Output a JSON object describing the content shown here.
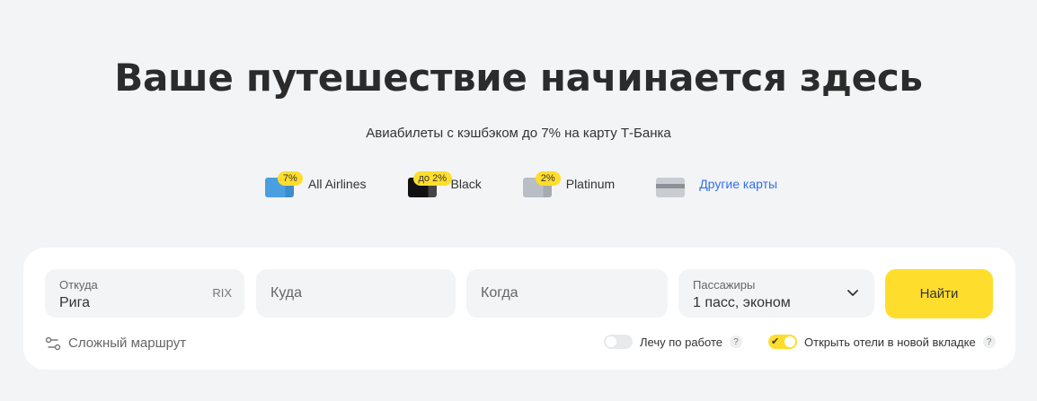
{
  "hero": {
    "title": "Ваше путешествие начинается здесь",
    "subtitle": "Авиабилеты с кэшбэком до 7% на карту Т-Банка"
  },
  "cards": [
    {
      "badge": "7%",
      "label": "All Airlines",
      "icon": "card-blue-icon"
    },
    {
      "badge": "до 2%",
      "label": "Black",
      "icon": "card-black-icon"
    },
    {
      "badge": "2%",
      "label": "Platinum",
      "icon": "card-gray-icon"
    },
    {
      "label": "Другие карты",
      "icon": "card-other-icon",
      "link": true
    }
  ],
  "search": {
    "from": {
      "label": "Откуда",
      "value": "Рига",
      "code": "RIX"
    },
    "to": {
      "placeholder": "Куда"
    },
    "when": {
      "placeholder": "Когда"
    },
    "passengers": {
      "label": "Пассажиры",
      "value": "1 пасс, эконом"
    },
    "submit_label": "Найти"
  },
  "options": {
    "complex_route": "Сложный маршрут",
    "work_trip": {
      "label": "Лечу по работе",
      "enabled": false
    },
    "open_hotels": {
      "label": "Открыть отели в новой вкладке",
      "enabled": true
    },
    "help_glyph": "?"
  },
  "colors": {
    "accent": "#ffdd2d",
    "link": "#336fee",
    "field_bg": "#f3f4f6"
  }
}
